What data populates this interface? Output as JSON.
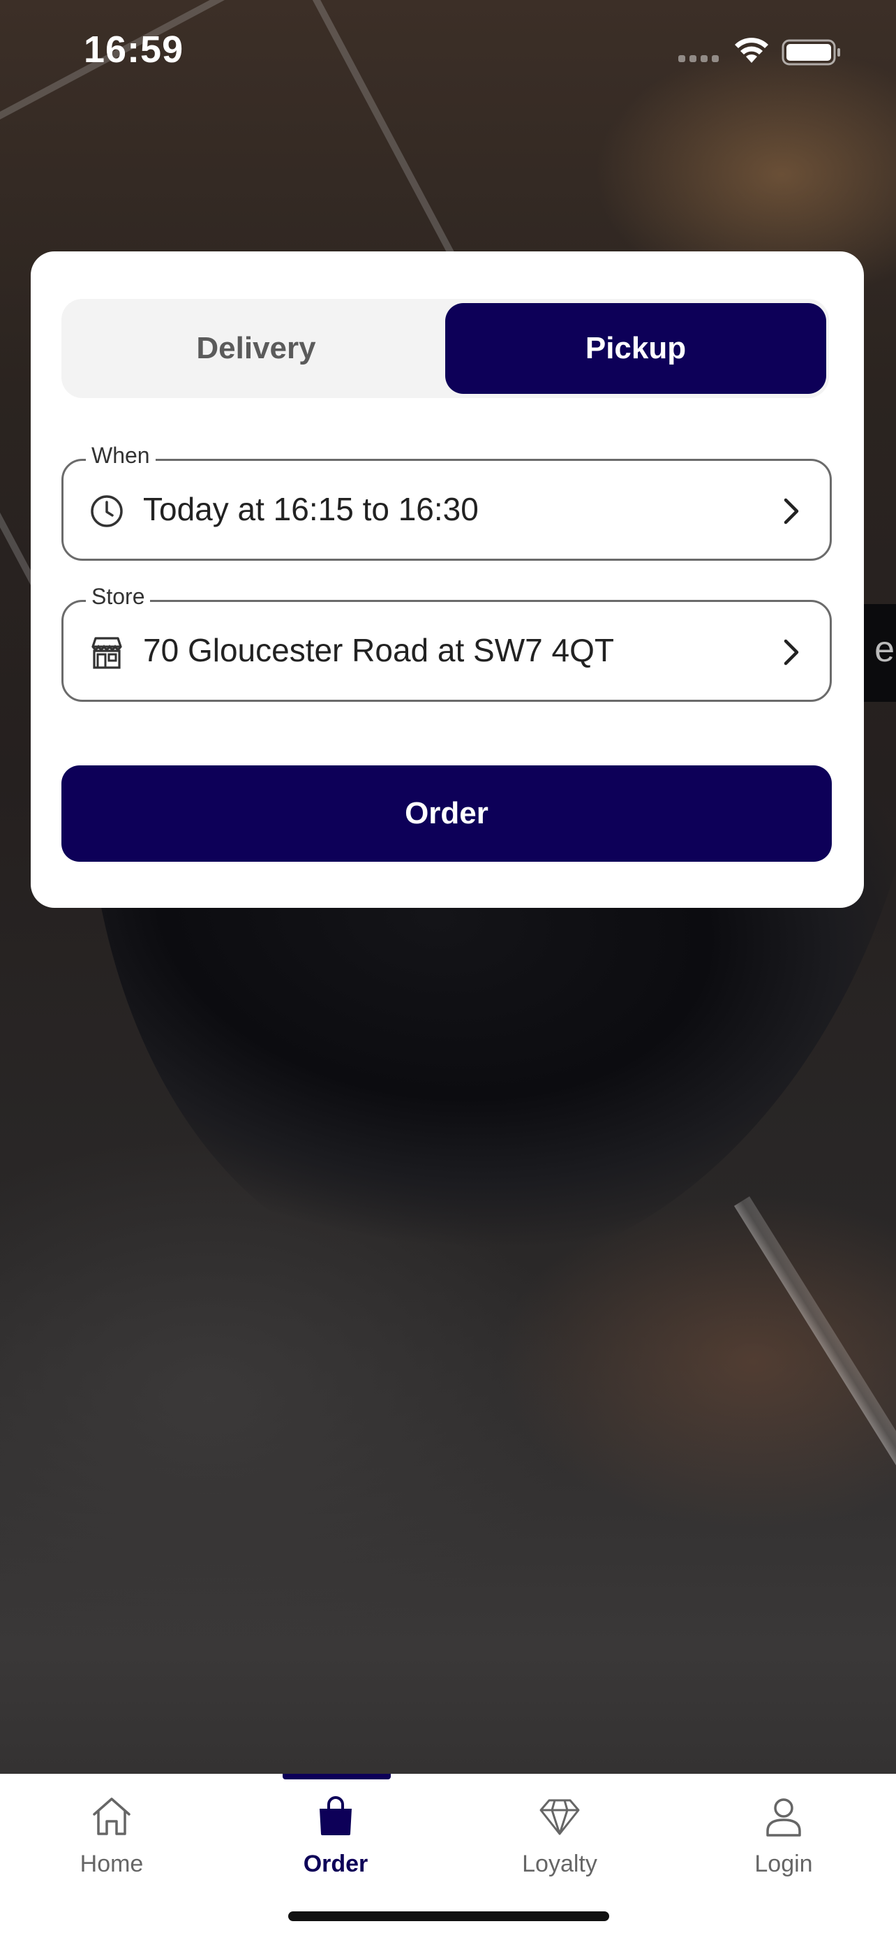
{
  "status_bar": {
    "time": "16:59"
  },
  "background": {
    "edge_letter": "e"
  },
  "order_card": {
    "mode_toggle": {
      "options": [
        "Delivery",
        "Pickup"
      ],
      "selected": "Pickup"
    },
    "when_field": {
      "legend": "When",
      "value": "Today at 16:15 to 16:30",
      "icon": "clock-icon"
    },
    "store_field": {
      "legend": "Store",
      "value": "70 Gloucester Road at SW7 4QT",
      "icon": "store-icon"
    },
    "order_button": "Order"
  },
  "tab_bar": {
    "active": "Order",
    "tabs": [
      {
        "label": "Home",
        "icon": "home-icon"
      },
      {
        "label": "Order",
        "icon": "shopping-bag-icon"
      },
      {
        "label": "Loyalty",
        "icon": "diamond-icon"
      },
      {
        "label": "Login",
        "icon": "user-icon"
      }
    ]
  },
  "colors": {
    "brand": "#0d0058",
    "card_bg": "#ffffff",
    "toggle_bg": "#f3f3f3"
  }
}
